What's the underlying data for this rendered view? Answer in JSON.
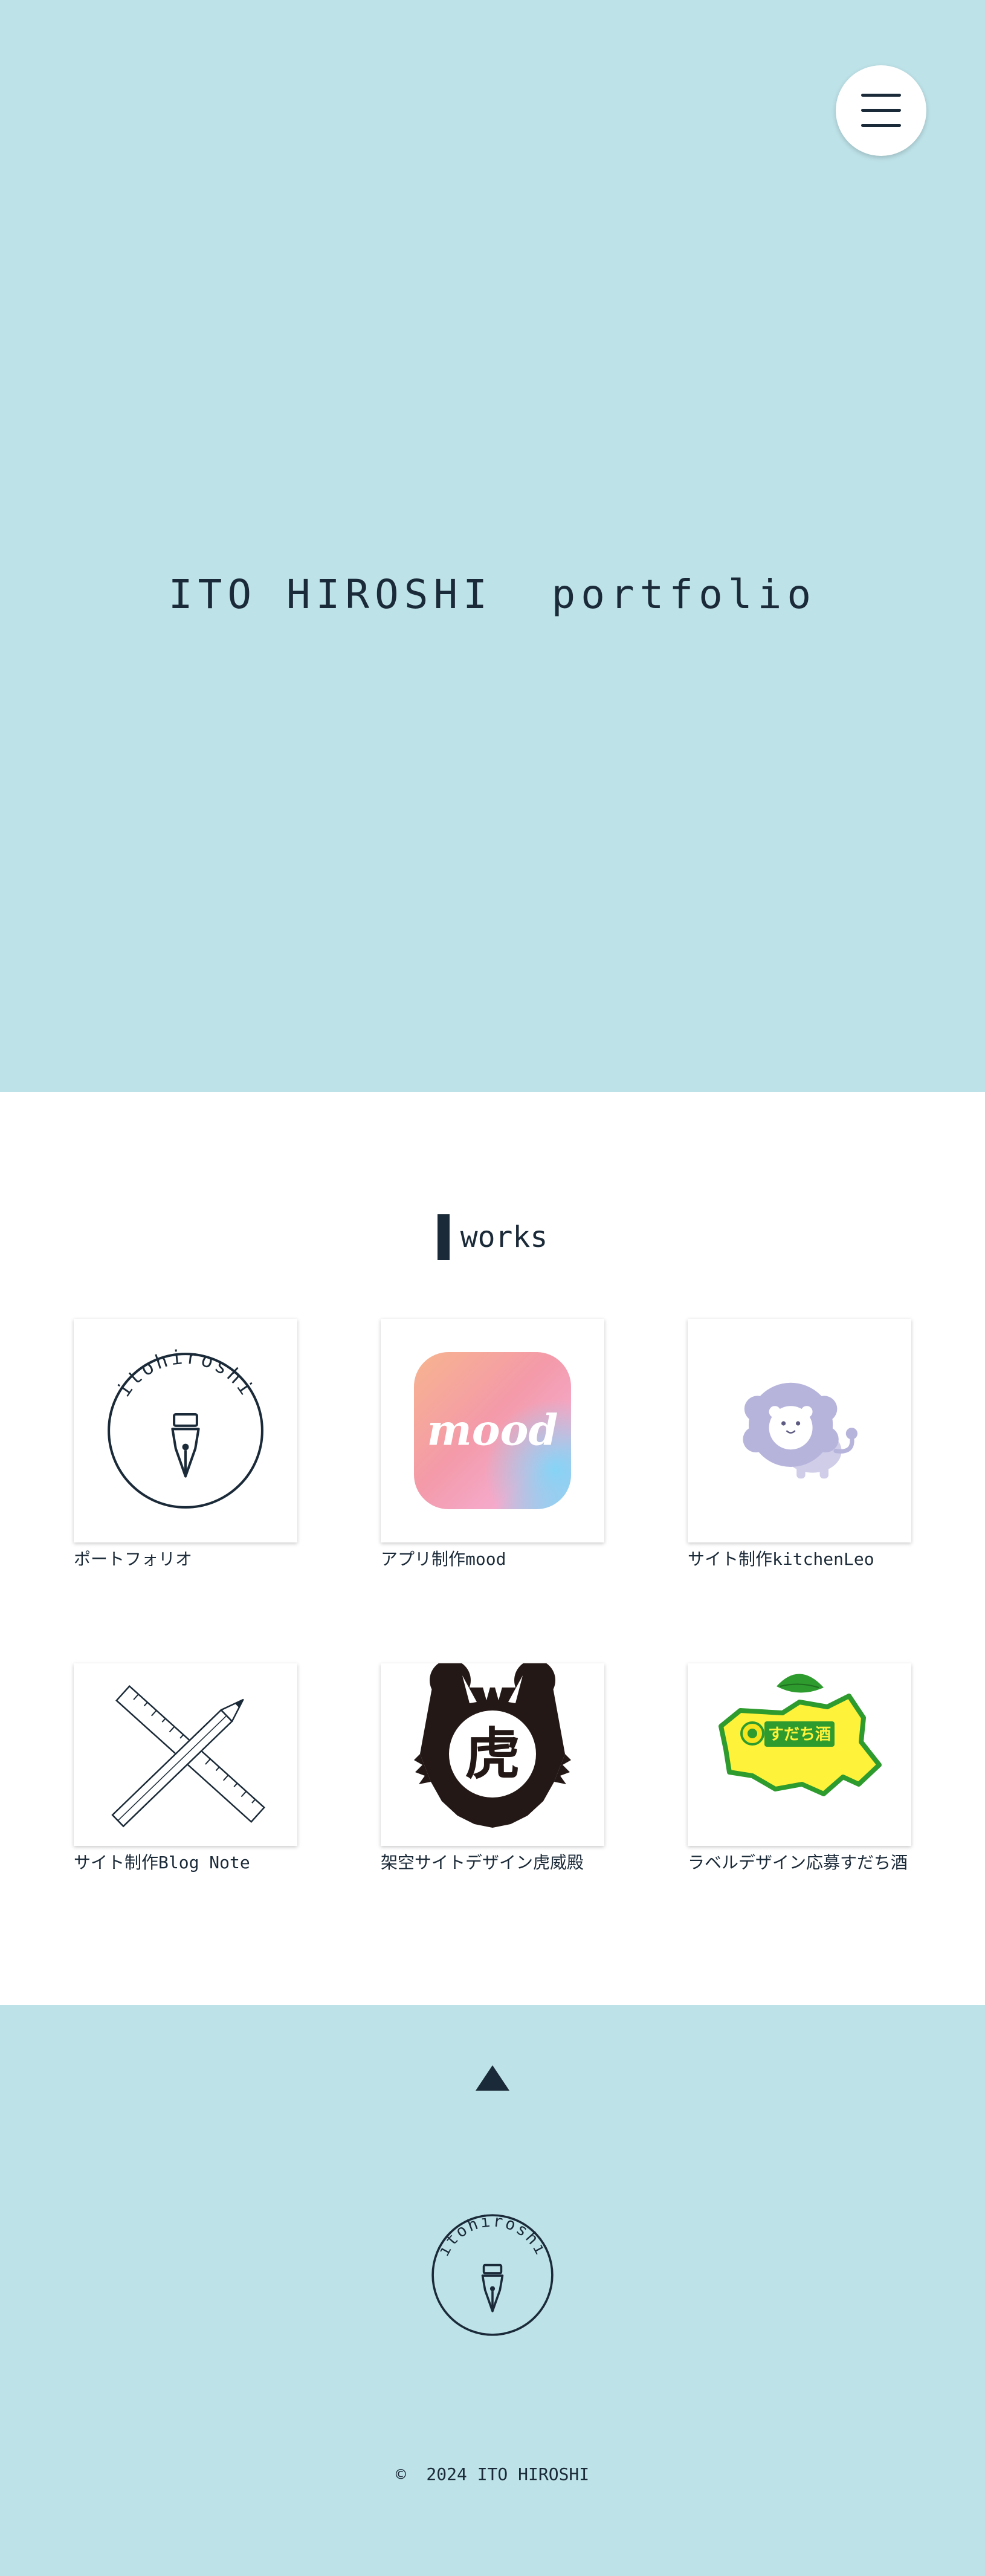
{
  "hero": {
    "title": "ITO HIROSHI  portfolio",
    "menu_icon": "hamburger-menu-icon",
    "background": "#bde2e8"
  },
  "works": {
    "heading": "works",
    "items": [
      {
        "caption": "ポートフォリオ",
        "logo_text": "itohiroshi",
        "icon": "fountain-pen-nib-logo"
      },
      {
        "caption": "アプリ制作mood",
        "logo_text": "mood",
        "icon": "mood-app-logo"
      },
      {
        "caption": "サイト制作kitchenLeo",
        "icon": "lion-illustration"
      },
      {
        "caption": "サイト制作Blog Note",
        "icon": "ruler-pencil-icon"
      },
      {
        "caption": "架空サイトデザイン虎威殿",
        "logo_text": "虎",
        "icon": "tiger-emblem-logo"
      },
      {
        "caption": "ラベルデザイン応募すだち酒",
        "logo_text": "すだち酒",
        "icon": "sudachi-label-logo"
      }
    ]
  },
  "footer": {
    "top_icon": "triangle-up-icon",
    "logo_text": "itohiroshi",
    "copyright": "©  2024 ITO HIROSHI"
  },
  "colors": {
    "accent": "#bde2e8",
    "text": "#1b2a38",
    "sudachi_yellow": "#fff23a",
    "sudachi_green": "#2e9b2e",
    "lion": "#b7b4dc"
  }
}
